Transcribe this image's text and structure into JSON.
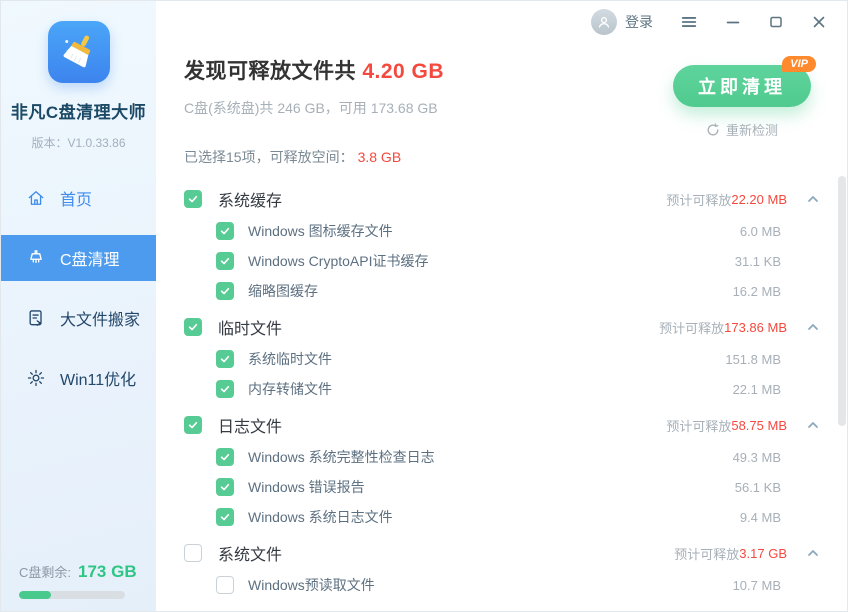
{
  "titlebar": {
    "login_label": "登录"
  },
  "sidebar": {
    "app_name": "非凡C盘清理大师",
    "version": "版本：V1.0.33.86",
    "items": [
      {
        "label": "首页",
        "icon": "home-icon",
        "active": false
      },
      {
        "label": "C盘清理",
        "icon": "brush-icon",
        "active": true
      },
      {
        "label": "大文件搬家",
        "icon": "file-move-icon",
        "active": false
      },
      {
        "label": "Win11优化",
        "icon": "gear-icon",
        "active": false
      }
    ],
    "disk_remaining_label": "C盘剩余:",
    "disk_remaining_value": "173 GB",
    "disk_used_percent": 30
  },
  "header": {
    "title_prefix": "发现可释放文件共 ",
    "title_value": "4.20 GB",
    "subtitle": "C盘(系统盘)共 246 GB，可用 173.68 GB",
    "clean_button": "立即清理",
    "vip_badge": "VIP",
    "redetect": "重新检测",
    "selection_prefix": "已选择15项，可释放空间：",
    "selection_value": "3.8 GB"
  },
  "list": {
    "estimate_prefix": "预计可释放",
    "categories": [
      {
        "name": "系统缓存",
        "checked": true,
        "estimate": "22.20 MB",
        "items": [
          {
            "name": "Windows 图标缓存文件",
            "size": "6.0 MB",
            "checked": true
          },
          {
            "name": "Windows CryptoAPI证书缓存",
            "size": "31.1 KB",
            "checked": true
          },
          {
            "name": "缩略图缓存",
            "size": "16.2 MB",
            "checked": true
          }
        ]
      },
      {
        "name": "临时文件",
        "checked": true,
        "estimate": "173.86 MB",
        "items": [
          {
            "name": "系统临时文件",
            "size": "151.8 MB",
            "checked": true
          },
          {
            "name": "内存转储文件",
            "size": "22.1 MB",
            "checked": true
          }
        ]
      },
      {
        "name": "日志文件",
        "checked": true,
        "estimate": "58.75 MB",
        "items": [
          {
            "name": "Windows 系统完整性检查日志",
            "size": "49.3 MB",
            "checked": true
          },
          {
            "name": "Windows 错误报告",
            "size": "56.1 KB",
            "checked": true
          },
          {
            "name": "Windows 系统日志文件",
            "size": "9.4 MB",
            "checked": true
          }
        ]
      },
      {
        "name": "系统文件",
        "checked": false,
        "estimate": "3.17 GB",
        "items": [
          {
            "name": "Windows预读取文件",
            "size": "10.7 MB",
            "checked": false
          }
        ]
      }
    ]
  },
  "colors": {
    "accent_blue": "#4d9bee",
    "accent_green": "#55cd92",
    "alert_red": "#f4493f",
    "vip_orange": "#ff8a2e"
  }
}
